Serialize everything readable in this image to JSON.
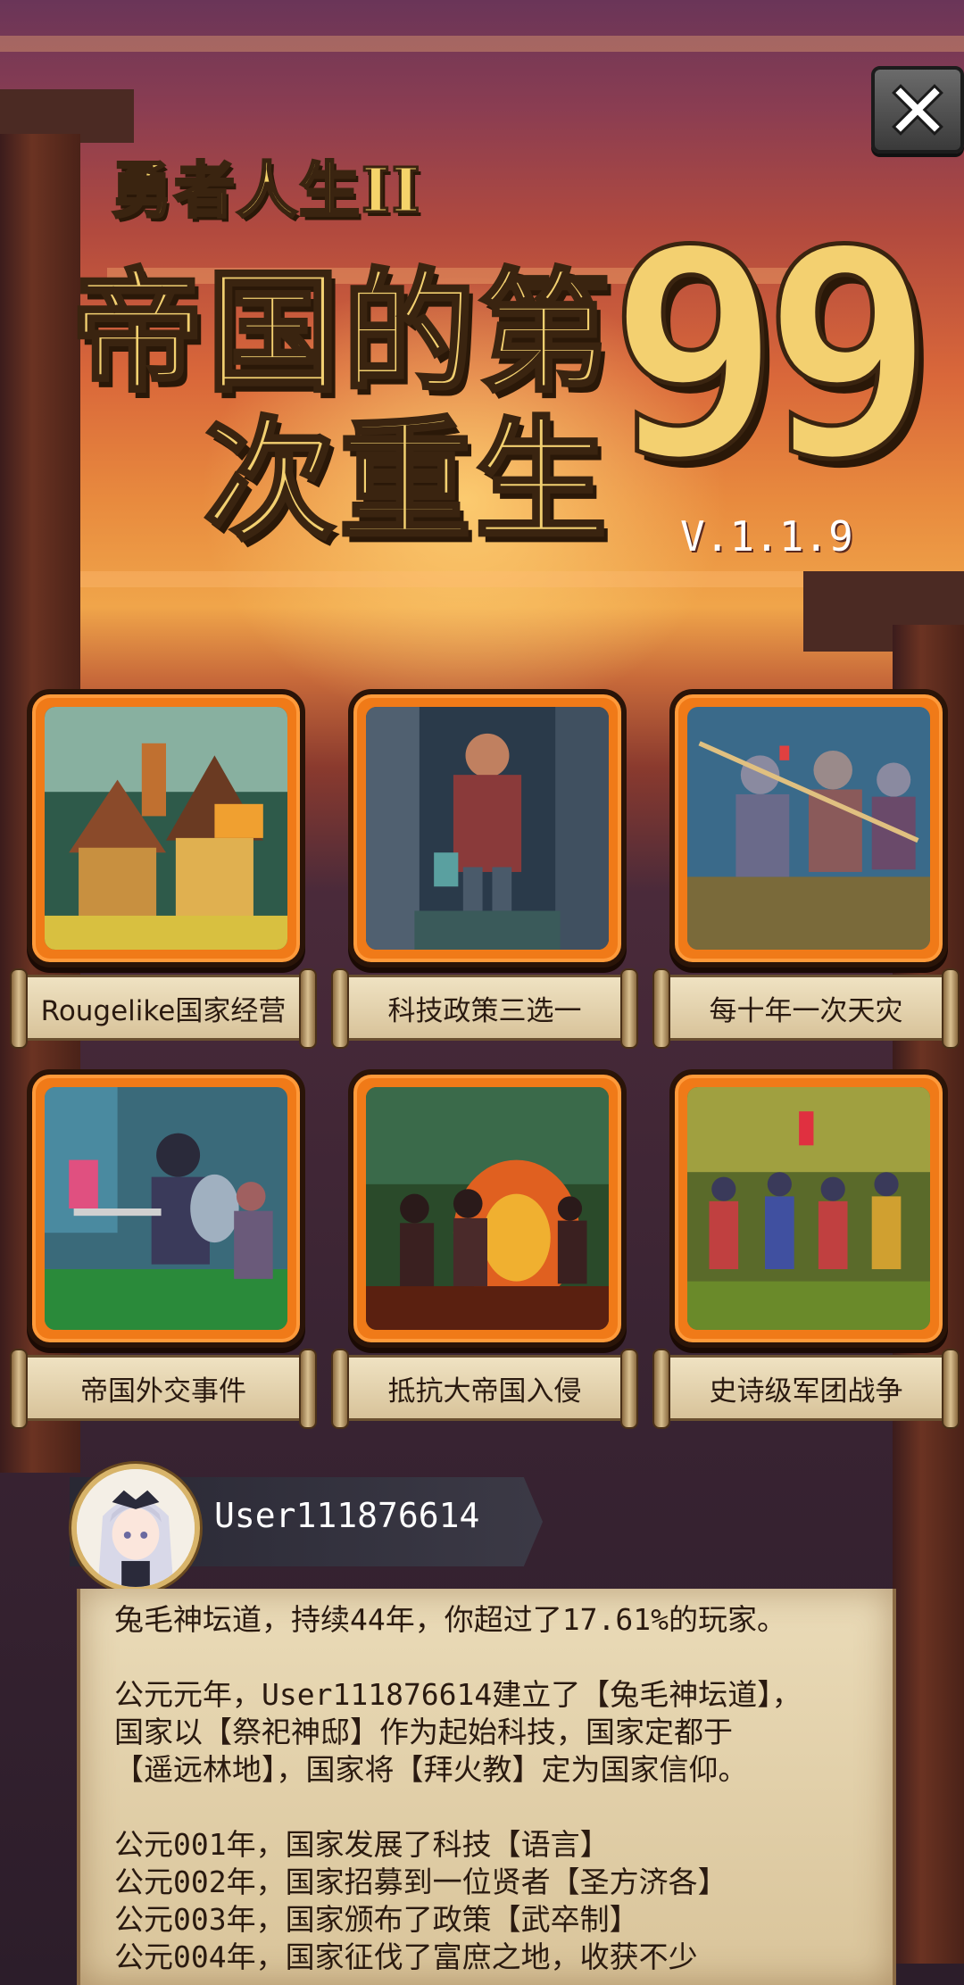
{
  "game": {
    "subtitle": "勇者人生II",
    "title_line1": "帝国的第",
    "title_line2": "次重生",
    "title_number": "99",
    "version": "V.1.1.9"
  },
  "close_icon": "close-icon",
  "features": [
    {
      "label": "Rougelike国家经营",
      "art": "village-art"
    },
    {
      "label": "科技政策三选一",
      "art": "statue-art"
    },
    {
      "label": "每十年一次天灾",
      "art": "knights-charge-art"
    },
    {
      "label": "帝国外交事件",
      "art": "knight-duel-art"
    },
    {
      "label": "抵抗大帝国入侵",
      "art": "burning-city-art"
    },
    {
      "label": "史诗级军团战争",
      "art": "army-march-art"
    }
  ],
  "user": {
    "name": "User111876614",
    "avatar": "anime-avatar"
  },
  "chronicle": {
    "summary": "兔毛神坛道，持续44年，你超过了17.61%的玩家。",
    "founding": [
      "公元元年，User111876614建立了【兔毛神坛道】，",
      "国家以【祭祀神邸】作为起始科技，国家定都于",
      "【遥远林地】，国家将【拜火教】定为国家信仰。"
    ],
    "events": [
      "公元001年，国家发展了科技【语言】",
      "公元002年，国家招募到一位贤者【圣方济各】",
      "公元003年，国家颁布了政策【武卒制】",
      "公元004年，国家征伐了富庶之地，收获不少"
    ]
  },
  "colors": {
    "frame_orange": "#f07a18",
    "title_gold": "#f3d070",
    "parchment": "#eadbb8"
  }
}
